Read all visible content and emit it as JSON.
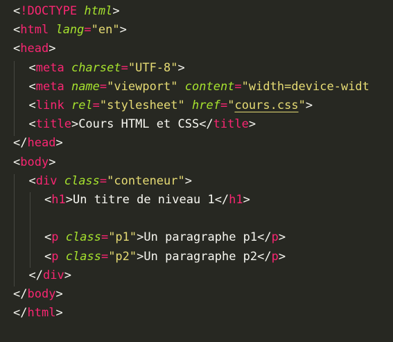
{
  "theme": {
    "background": "#272822",
    "tag": "#f92672",
    "attribute": "#a6e22e",
    "string": "#e6db74",
    "text": "#f8f8f2"
  },
  "editor": {
    "lines": [
      {
        "indent": 0,
        "tokens": [
          {
            "t": "bracket",
            "v": "<"
          },
          {
            "t": "doctype",
            "v": "!DOCTYPE"
          },
          {
            "t": "text",
            "v": " "
          },
          {
            "t": "doctype-name",
            "v": "html"
          },
          {
            "t": "bracket",
            "v": ">"
          }
        ]
      },
      {
        "indent": 0,
        "tokens": [
          {
            "t": "bracket",
            "v": "<"
          },
          {
            "t": "tag",
            "v": "html"
          },
          {
            "t": "text",
            "v": " "
          },
          {
            "t": "attr",
            "v": "lang"
          },
          {
            "t": "eq",
            "v": "="
          },
          {
            "t": "str",
            "v": "\"en\""
          },
          {
            "t": "bracket",
            "v": ">"
          }
        ]
      },
      {
        "indent": 0,
        "tokens": [
          {
            "t": "bracket",
            "v": "<"
          },
          {
            "t": "tag",
            "v": "head"
          },
          {
            "t": "bracket",
            "v": ">"
          }
        ]
      },
      {
        "indent": 1,
        "tokens": [
          {
            "t": "bracket",
            "v": "<"
          },
          {
            "t": "tag",
            "v": "meta"
          },
          {
            "t": "text",
            "v": " "
          },
          {
            "t": "attr",
            "v": "charset"
          },
          {
            "t": "eq",
            "v": "="
          },
          {
            "t": "str",
            "v": "\"UTF-8\""
          },
          {
            "t": "bracket",
            "v": ">"
          }
        ]
      },
      {
        "indent": 1,
        "tokens": [
          {
            "t": "bracket",
            "v": "<"
          },
          {
            "t": "tag",
            "v": "meta"
          },
          {
            "t": "text",
            "v": " "
          },
          {
            "t": "attr",
            "v": "name"
          },
          {
            "t": "eq",
            "v": "="
          },
          {
            "t": "str",
            "v": "\"viewport\""
          },
          {
            "t": "text",
            "v": " "
          },
          {
            "t": "attr",
            "v": "content"
          },
          {
            "t": "eq",
            "v": "="
          },
          {
            "t": "str",
            "v": "\"width=device-widt"
          }
        ]
      },
      {
        "indent": 1,
        "tokens": [
          {
            "t": "bracket",
            "v": "<"
          },
          {
            "t": "tag",
            "v": "link"
          },
          {
            "t": "text",
            "v": " "
          },
          {
            "t": "attr",
            "v": "rel"
          },
          {
            "t": "eq",
            "v": "="
          },
          {
            "t": "str",
            "v": "\"stylesheet\""
          },
          {
            "t": "text",
            "v": " "
          },
          {
            "t": "attr",
            "v": "href"
          },
          {
            "t": "eq",
            "v": "="
          },
          {
            "t": "str",
            "v": "\""
          },
          {
            "t": "str-link",
            "v": "cours.css"
          },
          {
            "t": "str",
            "v": "\""
          },
          {
            "t": "bracket",
            "v": ">"
          }
        ]
      },
      {
        "indent": 1,
        "tokens": [
          {
            "t": "bracket",
            "v": "<"
          },
          {
            "t": "tag",
            "v": "title"
          },
          {
            "t": "bracket",
            "v": ">"
          },
          {
            "t": "text",
            "v": "Cours HTML et CSS"
          },
          {
            "t": "bracket",
            "v": "</"
          },
          {
            "t": "tag",
            "v": "title"
          },
          {
            "t": "bracket",
            "v": ">"
          }
        ]
      },
      {
        "indent": 0,
        "tokens": [
          {
            "t": "bracket",
            "v": "</"
          },
          {
            "t": "tag",
            "v": "head"
          },
          {
            "t": "bracket",
            "v": ">"
          }
        ]
      },
      {
        "indent": 0,
        "tokens": [
          {
            "t": "bracket",
            "v": "<"
          },
          {
            "t": "tag",
            "v": "body"
          },
          {
            "t": "bracket",
            "v": ">"
          }
        ]
      },
      {
        "indent": 1,
        "tokens": [
          {
            "t": "bracket",
            "v": "<"
          },
          {
            "t": "tag",
            "v": "div"
          },
          {
            "t": "text",
            "v": " "
          },
          {
            "t": "attr",
            "v": "class"
          },
          {
            "t": "eq",
            "v": "="
          },
          {
            "t": "str",
            "v": "\"conteneur\""
          },
          {
            "t": "bracket",
            "v": ">"
          }
        ]
      },
      {
        "indent": 2,
        "tokens": [
          {
            "t": "bracket",
            "v": "<"
          },
          {
            "t": "tag",
            "v": "h1"
          },
          {
            "t": "bracket",
            "v": ">"
          },
          {
            "t": "text",
            "v": "Un titre de niveau 1"
          },
          {
            "t": "bracket",
            "v": "</"
          },
          {
            "t": "tag",
            "v": "h1"
          },
          {
            "t": "bracket",
            "v": ">"
          }
        ]
      },
      {
        "indent": 2,
        "tokens": []
      },
      {
        "indent": 2,
        "tokens": [
          {
            "t": "bracket",
            "v": "<"
          },
          {
            "t": "tag",
            "v": "p"
          },
          {
            "t": "text",
            "v": " "
          },
          {
            "t": "attr",
            "v": "class"
          },
          {
            "t": "eq",
            "v": "="
          },
          {
            "t": "str",
            "v": "\"p1\""
          },
          {
            "t": "bracket",
            "v": ">"
          },
          {
            "t": "text",
            "v": "Un paragraphe p1"
          },
          {
            "t": "bracket",
            "v": "</"
          },
          {
            "t": "tag",
            "v": "p"
          },
          {
            "t": "bracket",
            "v": ">"
          }
        ]
      },
      {
        "indent": 2,
        "tokens": [
          {
            "t": "bracket",
            "v": "<"
          },
          {
            "t": "tag",
            "v": "p"
          },
          {
            "t": "text",
            "v": " "
          },
          {
            "t": "attr",
            "v": "class"
          },
          {
            "t": "eq",
            "v": "="
          },
          {
            "t": "str",
            "v": "\"p2\""
          },
          {
            "t": "bracket",
            "v": ">"
          },
          {
            "t": "text",
            "v": "Un paragraphe p2"
          },
          {
            "t": "bracket",
            "v": "</"
          },
          {
            "t": "tag",
            "v": "p"
          },
          {
            "t": "bracket",
            "v": ">"
          }
        ]
      },
      {
        "indent": 1,
        "tokens": [
          {
            "t": "bracket",
            "v": "</"
          },
          {
            "t": "tag",
            "v": "div"
          },
          {
            "t": "bracket",
            "v": ">"
          }
        ]
      },
      {
        "indent": 0,
        "tokens": [
          {
            "t": "bracket",
            "v": "</"
          },
          {
            "t": "tag",
            "v": "body"
          },
          {
            "t": "bracket",
            "v": ">"
          }
        ]
      },
      {
        "indent": 0,
        "tokens": [
          {
            "t": "bracket",
            "v": "</"
          },
          {
            "t": "tag",
            "v": "html"
          },
          {
            "t": "bracket",
            "v": ">"
          }
        ]
      }
    ]
  }
}
